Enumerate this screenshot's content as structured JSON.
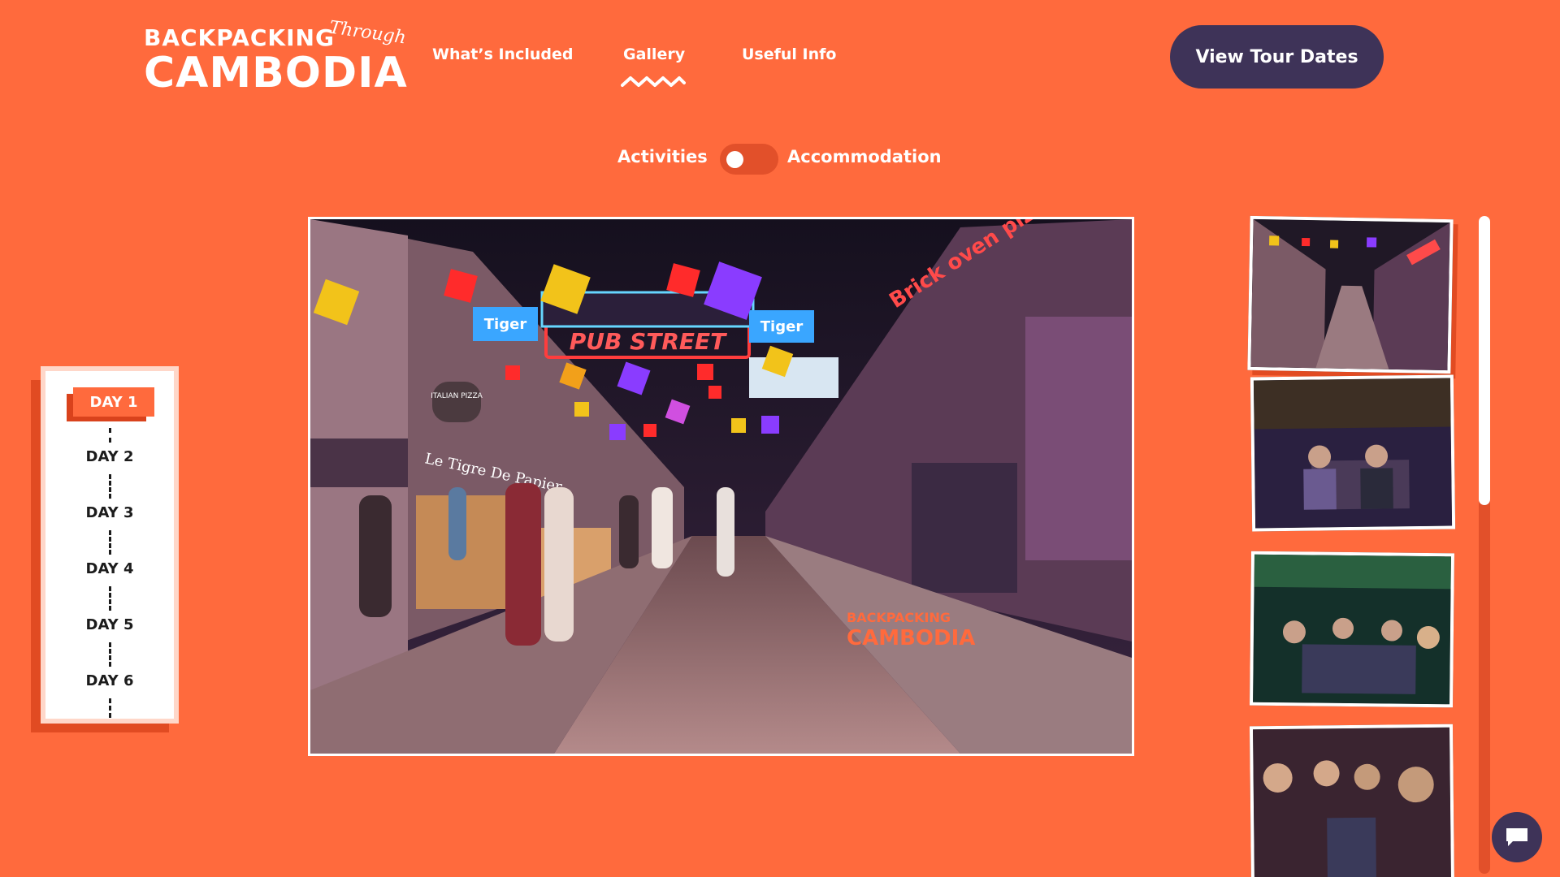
{
  "logo": {
    "line1": "BACKPACKING",
    "line2": "Through",
    "line3": "CAMBODIA"
  },
  "nav": [
    {
      "label": "What’s Included"
    },
    {
      "label": "Gallery",
      "active": true
    },
    {
      "label": "Useful Info"
    }
  ],
  "cta": {
    "label": "View Tour Dates"
  },
  "toggle": {
    "left_label": "Activities",
    "right_label": "Accommodation",
    "selected": "Activities"
  },
  "days": [
    {
      "label": "DAY 1",
      "active": true
    },
    {
      "label": "DAY 2"
    },
    {
      "label": "DAY 3"
    },
    {
      "label": "DAY 4"
    },
    {
      "label": "DAY 5"
    },
    {
      "label": "DAY 6"
    }
  ],
  "main_photo": {
    "signs": {
      "pub_street": "PUB STREET",
      "brick_oven": "Brick oven pizza",
      "italian_pizza": "ITALIAN PIZZA",
      "le_tigre": "Le Tigre De Papier",
      "tiger": "Tiger"
    },
    "watermark_line1": "BACKPACKING",
    "watermark_line2": "CAMBODIA"
  },
  "icons": {
    "chat": "chat-bubble-icon",
    "squiggle": "active-indicator-icon"
  },
  "colors": {
    "background": "#ff6a3d",
    "button": "#3e3358",
    "accent_dark": "#e14b22"
  }
}
